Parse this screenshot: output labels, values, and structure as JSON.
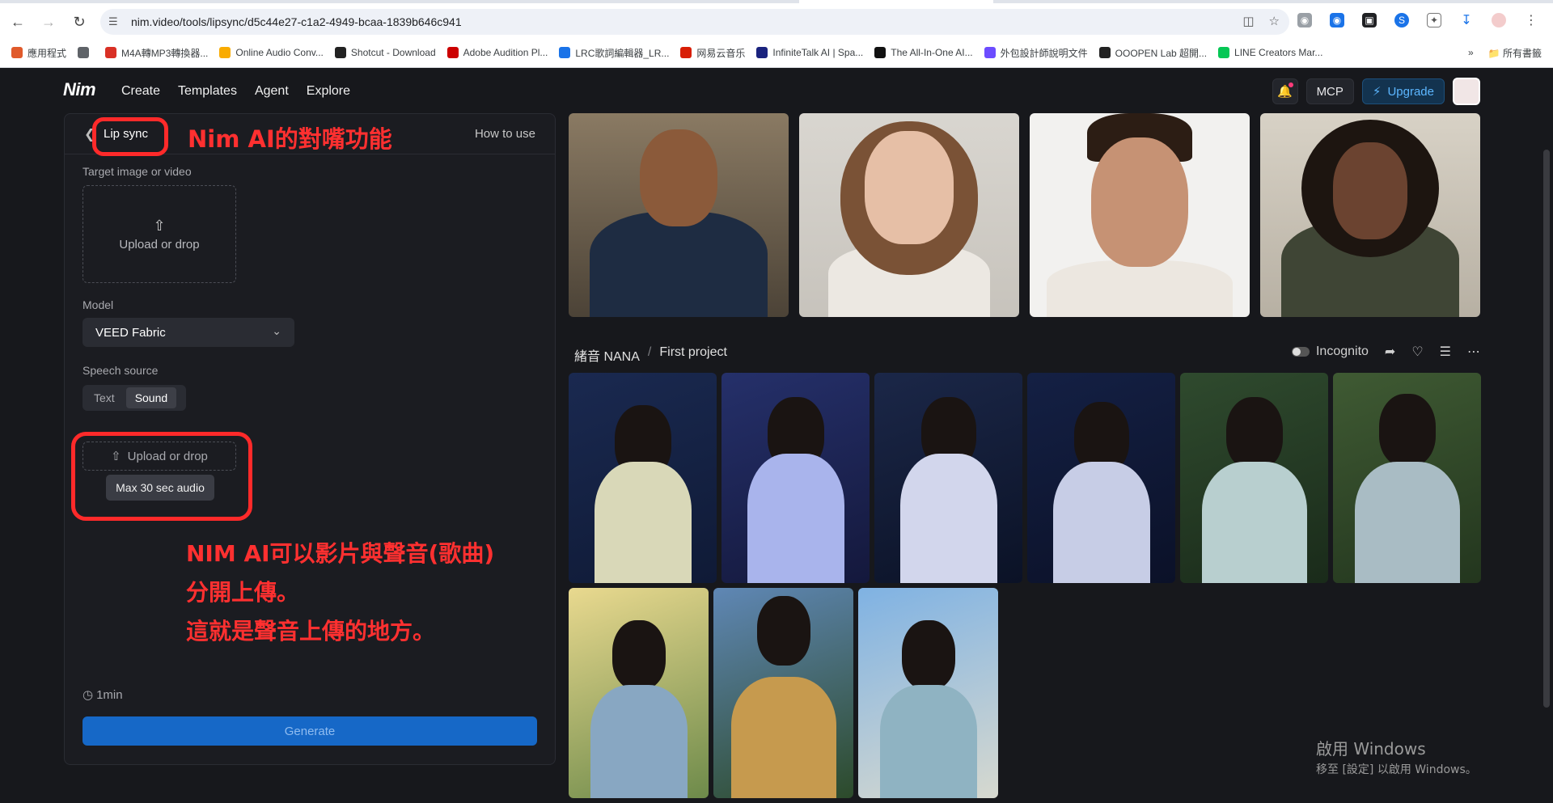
{
  "browser": {
    "url": "nim.video/tools/lipsync/d5c44e27-c1a2-4949-bcaa-1839b646c941",
    "bookmarks": [
      {
        "label": "應用程式",
        "color": "#e05a2b"
      },
      {
        "label": "",
        "color": "#5f6368"
      },
      {
        "label": "M4A轉MP3轉換器...",
        "color": "#d93025"
      },
      {
        "label": "Online Audio Conv...",
        "color": "#f9ab00"
      },
      {
        "label": "Shotcut - Download",
        "color": "#222222"
      },
      {
        "label": "Adobe Audition Pl...",
        "color": "#cc0000"
      },
      {
        "label": "LRC歌詞編輯器_LR...",
        "color": "#1a73e8"
      },
      {
        "label": "网易云音乐",
        "color": "#d81e06"
      },
      {
        "label": "InfiniteTalk AI | Spa...",
        "color": "#1a237e"
      },
      {
        "label": "The All-In-One AI...",
        "color": "#111111"
      },
      {
        "label": "外包設計師說明文件",
        "color": "#6c4cff"
      },
      {
        "label": "OOOPEN Lab 超開...",
        "color": "#222222"
      },
      {
        "label": "LINE Creators Mar...",
        "color": "#06c755"
      }
    ],
    "all_bookmarks": "所有書籤"
  },
  "app": {
    "logo": "Nim",
    "nav": [
      "Create",
      "Templates",
      "Agent",
      "Explore"
    ],
    "mcp": "MCP",
    "upgrade": "Upgrade"
  },
  "panel": {
    "title": "Lip sync",
    "how_to_use": "How to use",
    "annotation_title": "Nim AI的對嘴功能",
    "target_label": "Target image or video",
    "upload_label": "Upload or drop",
    "model_label": "Model",
    "model_value": "VEED Fabric",
    "speech_label": "Speech source",
    "speech_options": [
      "Text",
      "Sound"
    ],
    "speech_selected": "Sound",
    "sound_upload": "Upload or drop",
    "tooltip": "Max 30 sec audio",
    "annotation_body": [
      "NIM AI可以影片與聲音(歌曲)",
      "分開上傳。",
      "這就是聲音上傳的地方。"
    ],
    "duration": "1min",
    "generate": "Generate"
  },
  "gallery": {
    "owner": "緒音 NANA",
    "project": "First project",
    "incognito": "Incognito"
  },
  "watermark": {
    "line1": "啟用 Windows",
    "line2": "移至 [設定] 以啟用 Windows。"
  }
}
